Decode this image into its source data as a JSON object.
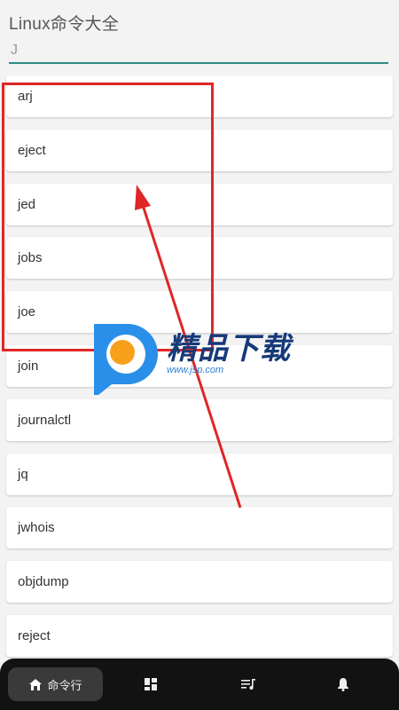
{
  "header": {
    "title": "Linux命令大全"
  },
  "search": {
    "value": "J",
    "placeholder": ""
  },
  "commands": [
    "arj",
    "eject",
    "jed",
    "jobs",
    "joe",
    "join",
    "journalctl",
    "jq",
    "jwhois",
    "objdump",
    "reject"
  ],
  "nav": {
    "items": [
      {
        "icon": "home-icon",
        "label": "命令行",
        "active": true
      },
      {
        "icon": "dashboard-icon",
        "label": ""
      },
      {
        "icon": "playlist-icon",
        "label": ""
      },
      {
        "icon": "bell-icon",
        "label": ""
      }
    ]
  },
  "watermark": {
    "title": "精品下载",
    "url": "www.jsp.com"
  },
  "colors": {
    "accent": "#2e8c82",
    "annotation": "#e02626",
    "nav_bg": "#121212"
  }
}
